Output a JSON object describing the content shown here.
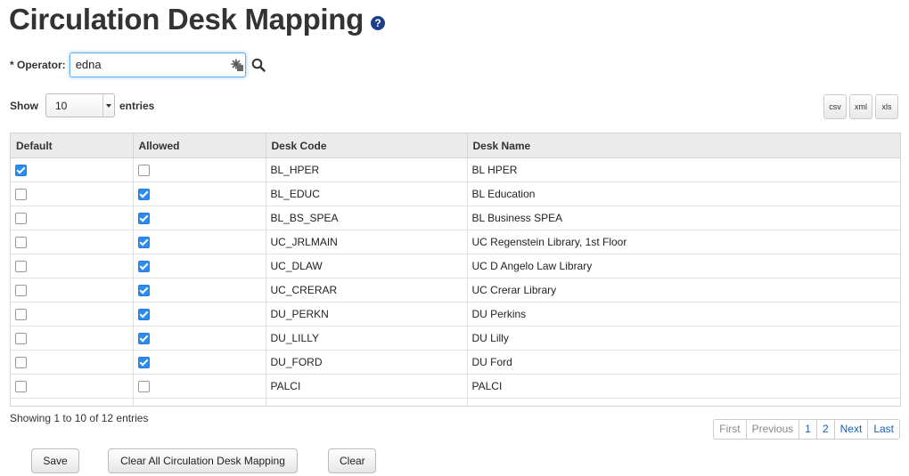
{
  "page": {
    "title": "Circulation Desk Mapping",
    "help_icon": "?"
  },
  "operator": {
    "label": "* Operator:",
    "value": "edna"
  },
  "length": {
    "show_label": "Show",
    "value": "10",
    "entries_label": "entries"
  },
  "export": {
    "csv": "csv",
    "xml": "xml",
    "xls": "xls"
  },
  "table": {
    "headers": [
      "Default",
      "Allowed",
      "Desk Code",
      "Desk Name"
    ],
    "rows": [
      {
        "default": true,
        "allowed": false,
        "code": "BL_HPER",
        "name": "BL HPER"
      },
      {
        "default": false,
        "allowed": true,
        "code": "BL_EDUC",
        "name": "BL Education"
      },
      {
        "default": false,
        "allowed": true,
        "code": "BL_BS_SPEA",
        "name": "BL Business SPEA"
      },
      {
        "default": false,
        "allowed": true,
        "code": "UC_JRLMAIN",
        "name": "UC Regenstein Library, 1st Floor"
      },
      {
        "default": false,
        "allowed": true,
        "code": "UC_DLAW",
        "name": "UC D Angelo Law Library"
      },
      {
        "default": false,
        "allowed": true,
        "code": "UC_CRERAR",
        "name": "UC Crerar Library"
      },
      {
        "default": false,
        "allowed": true,
        "code": "DU_PERKN",
        "name": "DU Perkins"
      },
      {
        "default": false,
        "allowed": true,
        "code": "DU_LILLY",
        "name": "DU Lilly"
      },
      {
        "default": false,
        "allowed": true,
        "code": "DU_FORD",
        "name": "DU Ford"
      },
      {
        "default": false,
        "allowed": false,
        "code": "PALCI",
        "name": "PALCI"
      }
    ]
  },
  "info": "Showing 1 to 10 of 12 entries",
  "pagination": {
    "first": "First",
    "previous": "Previous",
    "page1": "1",
    "page2": "2",
    "next": "Next",
    "last": "Last"
  },
  "actions": {
    "save": "Save",
    "clear_all": "Clear All Circulation Desk Mapping",
    "clear": "Clear"
  },
  "colors": {
    "link": "#1a5fb4",
    "checkbox_checked": "#2a8bf2",
    "header_bg": "#ebebeb",
    "help_icon": "#1d3f8a"
  }
}
